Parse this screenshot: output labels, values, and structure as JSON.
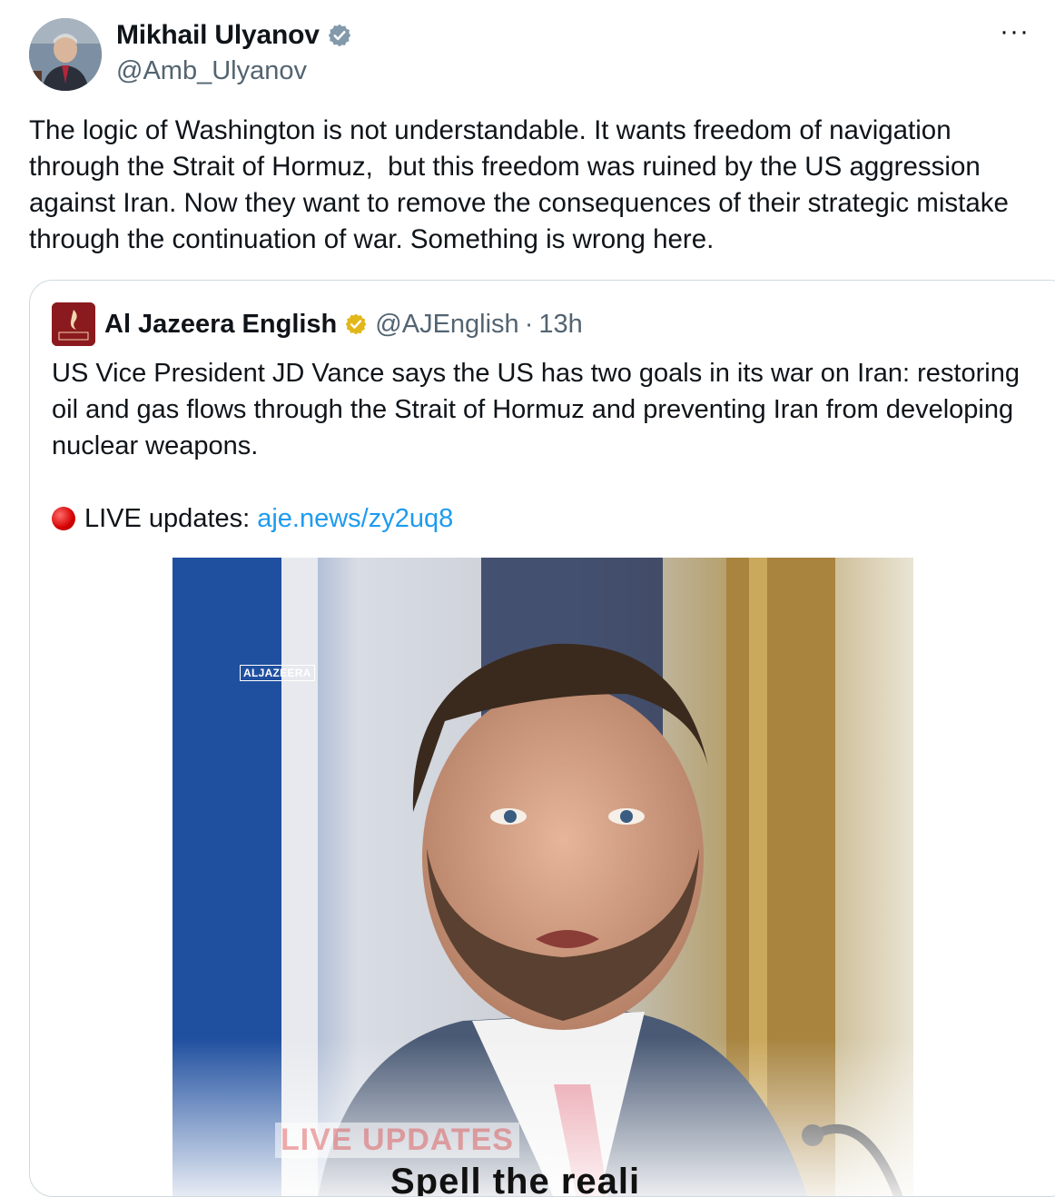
{
  "tweet": {
    "author_name": "Mikhail Ulyanov",
    "handle": "@Amb_Ulyanov",
    "more_label": "···",
    "text": "The logic of Washington is not understandable. It wants freedom of navigation through the Strait of Hormuz,  but this freedom was ruined by the US aggression against Iran. Now they want to remove the consequences of their strategic mistake through the continuation of war. Something is wrong here."
  },
  "quote": {
    "author_name": "Al Jazeera English",
    "handle": "@AJEnglish",
    "separator": "·",
    "time": "13h",
    "text": "US Vice President JD Vance says the US has two goals in its war on Iran: restoring oil and gas flows through the Strait of Hormuz and preventing Iran from developing nuclear weapons.",
    "live_label": "LIVE updates:",
    "live_link": "aje.news/zy2uq8",
    "media": {
      "logo_text": "ALJAZEERA",
      "banner_text": "LIVE UPDATES",
      "cut_text": "Spell the reali"
    }
  },
  "colors": {
    "verified_blue": "#829aab",
    "verified_gold": "#e2b719",
    "link": "#1d9bf0",
    "muted": "#536471",
    "aj_red": "#8b1a1e"
  },
  "icons": [
    "verified-badge-icon",
    "gold-verified-badge-icon",
    "more-options-icon",
    "red-circle-icon"
  ]
}
